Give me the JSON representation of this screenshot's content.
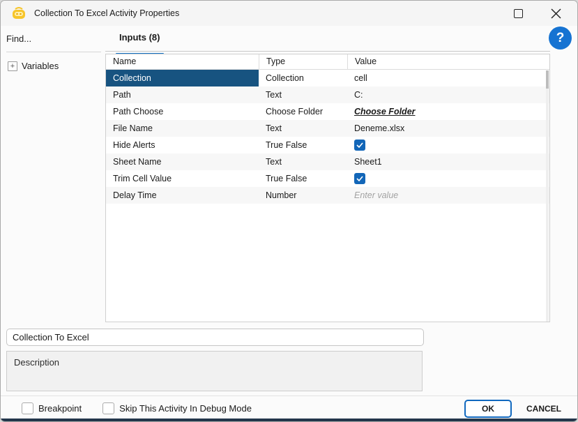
{
  "window": {
    "title": "Collection To Excel Activity Properties"
  },
  "sidebar": {
    "find_placeholder": "Find...",
    "tree": [
      {
        "label": "Variables",
        "expander_glyph": "+",
        "state": "collapsed"
      }
    ]
  },
  "tabs": [
    {
      "label": "Inputs (8)",
      "active": true
    }
  ],
  "help": {
    "glyph": "?"
  },
  "table": {
    "columns": [
      "Name",
      "Type",
      "Value"
    ],
    "rows": [
      {
        "name": "Collection",
        "type": "Collection",
        "value": "cell",
        "value_kind": "text",
        "selected": true
      },
      {
        "name": "Path",
        "type": "Text",
        "value": "C:",
        "value_kind": "text"
      },
      {
        "name": "Path Choose",
        "type": "Choose Folder",
        "value": "Choose Folder",
        "value_kind": "link"
      },
      {
        "name": "File Name",
        "type": "Text",
        "value": "Deneme.xlsx",
        "value_kind": "text"
      },
      {
        "name": "Hide Alerts",
        "type": "True False",
        "value": "true",
        "value_kind": "checkbox"
      },
      {
        "name": "Sheet Name",
        "type": "Text",
        "value": "Sheet1",
        "value_kind": "text"
      },
      {
        "name": "Trim Cell Value",
        "type": "True False",
        "value": "true",
        "value_kind": "checkbox"
      },
      {
        "name": "Delay Time",
        "type": "Number",
        "value": "",
        "value_kind": "input",
        "placeholder": "Enter value"
      }
    ]
  },
  "name_field": {
    "value": "Collection To Excel"
  },
  "description_field": {
    "value": "",
    "placeholder": "Description"
  },
  "footer": {
    "checkboxes": [
      {
        "label": "Breakpoint",
        "checked": false
      },
      {
        "label": "Skip This Activity In Debug Mode",
        "checked": false
      }
    ],
    "ok_label": "OK",
    "cancel_label": "CANCEL"
  },
  "colors": {
    "accent_blue": "#1068bf",
    "tab_underline": "#1271c4",
    "selected_row": "#175380",
    "checkbox_checked": "#1266b8",
    "help_icon": "#1673d2",
    "window_bottom_edge": "#22354a"
  }
}
